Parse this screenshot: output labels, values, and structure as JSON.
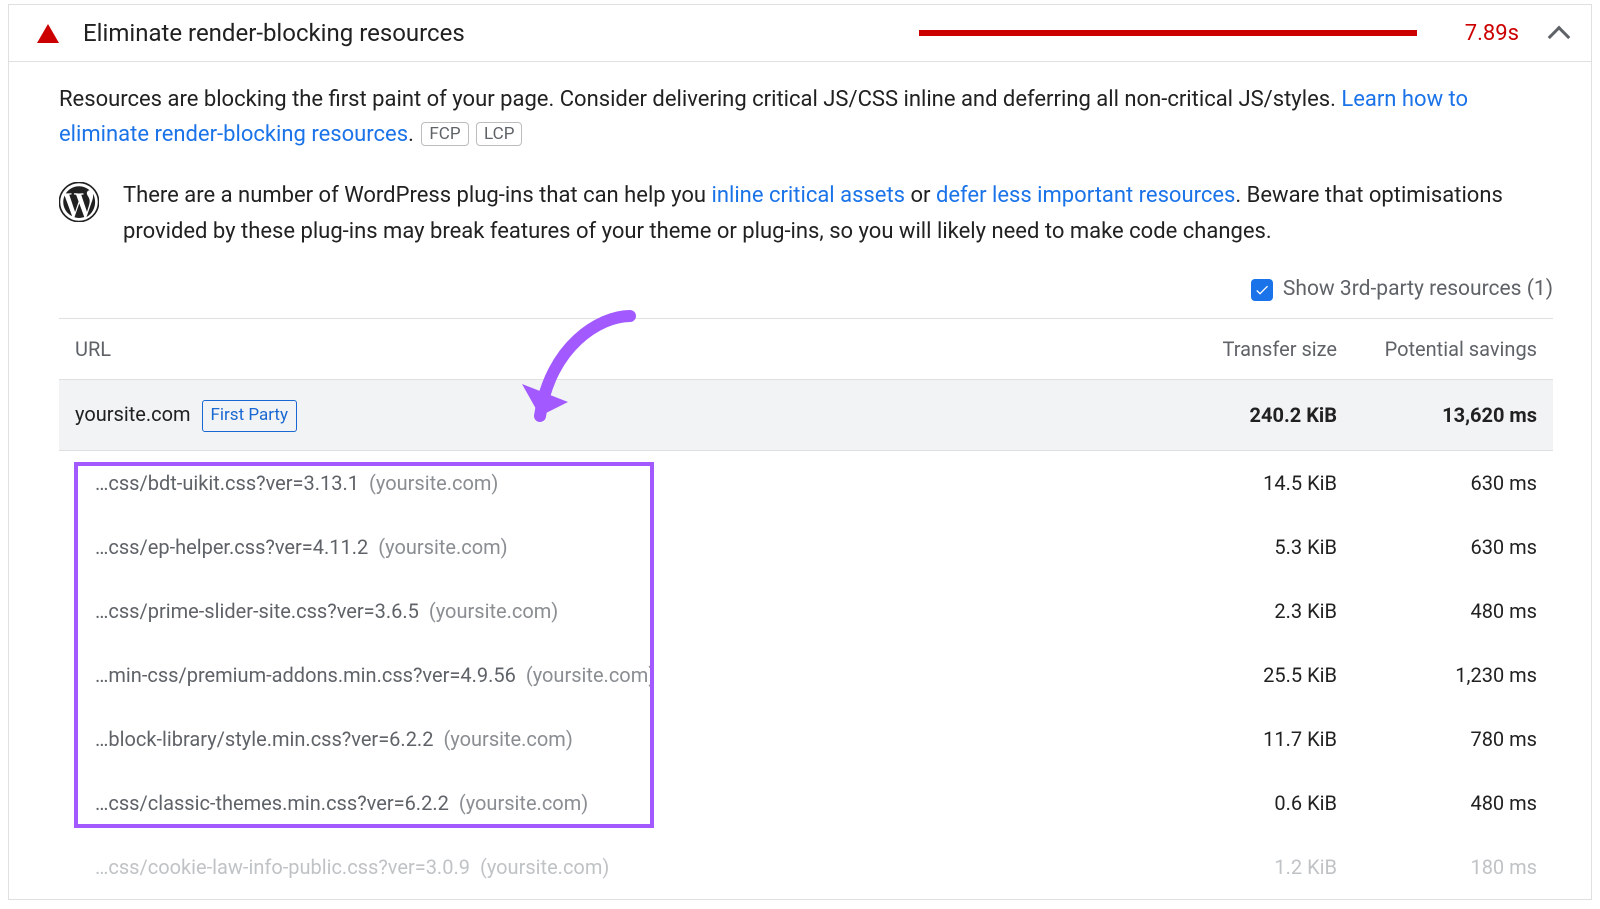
{
  "header": {
    "title": "Eliminate render-blocking resources",
    "duration": "7.89s"
  },
  "description": {
    "text_before_link": "Resources are blocking the first paint of your page. Consider delivering critical JS/CSS inline and deferring all non-critical JS/styles. ",
    "link": "Learn how to eliminate render-blocking resources",
    "after_link": ".",
    "chip1": "FCP",
    "chip2": "LCP"
  },
  "wordpress_tip": {
    "before1": "There are a number of WordPress plug-ins that can help you ",
    "link1": "inline critical assets",
    "mid": " or ",
    "link2": "defer less important resources",
    "after": ". Beware that optimisations provided by these plug-ins may break features of your theme or plug-ins, so you will likely need to make code changes."
  },
  "third_party": {
    "label": "Show 3rd-party resources (1)"
  },
  "table": {
    "head_url": "URL",
    "head_size": "Transfer size",
    "head_savings": "Potential savings",
    "group": {
      "host": "yoursite.com",
      "tag": "First Party",
      "size": "240.2 KiB",
      "savings": "13,620 ms"
    },
    "rows": [
      {
        "path": "…css/bdt-uikit.css?ver=3.13.1",
        "host": "(yoursite.com)",
        "size": "14.5 KiB",
        "savings": "630 ms",
        "faded": false
      },
      {
        "path": "…css/ep-helper.css?ver=4.11.2",
        "host": "(yoursite.com)",
        "size": "5.3 KiB",
        "savings": "630 ms",
        "faded": false
      },
      {
        "path": "…css/prime-slider-site.css?ver=3.6.5",
        "host": "(yoursite.com)",
        "size": "2.3 KiB",
        "savings": "480 ms",
        "faded": false
      },
      {
        "path": "…min-css/premium-addons.min.css?ver=4.9.56",
        "host": "(yoursite.com)",
        "size": "25.5 KiB",
        "savings": "1,230 ms",
        "faded": false
      },
      {
        "path": "…block-library/style.min.css?ver=6.2.2",
        "host": "(yoursite.com)",
        "size": "11.7 KiB",
        "savings": "780 ms",
        "faded": false
      },
      {
        "path": "…css/classic-themes.min.css?ver=6.2.2",
        "host": "(yoursite.com)",
        "size": "0.6 KiB",
        "savings": "480 ms",
        "faded": false
      },
      {
        "path": "…css/cookie-law-info-public.css?ver=3.0.9",
        "host": "(yoursite.com)",
        "size": "1.2 KiB",
        "savings": "180 ms",
        "faded": true
      }
    ]
  }
}
